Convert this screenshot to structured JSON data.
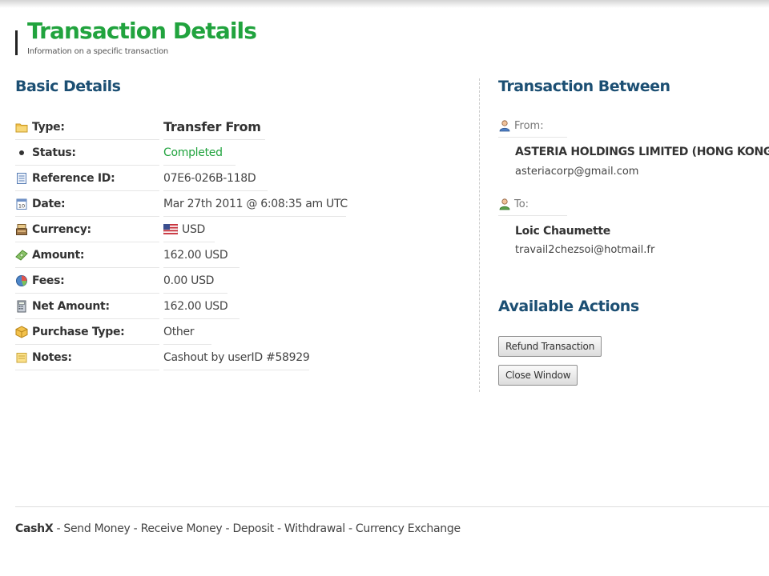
{
  "header": {
    "title": "Transaction Details",
    "subtitle": "Information on a specific transaction"
  },
  "basic_details": {
    "heading": "Basic Details",
    "rows": [
      {
        "label": "Type:",
        "value": "Transfer From",
        "icon": "folder-icon"
      },
      {
        "label": "Status:",
        "value": "Completed",
        "icon": "bullet-icon"
      },
      {
        "label": "Reference ID:",
        "value": "07E6-026B-118D",
        "icon": "document-icon"
      },
      {
        "label": "Date:",
        "value": "Mar 27th 2011 @ 6:08:35 am UTC",
        "icon": "calendar-icon"
      },
      {
        "label": "Currency:",
        "value": "USD",
        "icon": "cash-register-icon"
      },
      {
        "label": "Amount:",
        "value": "162.00 USD",
        "icon": "money-icon"
      },
      {
        "label": "Fees:",
        "value": "0.00 USD",
        "icon": "pie-chart-icon"
      },
      {
        "label": "Net Amount:",
        "value": "162.00 USD",
        "icon": "calculator-icon"
      },
      {
        "label": "Purchase Type:",
        "value": "Other",
        "icon": "box-icon"
      },
      {
        "label": "Notes:",
        "value": "Cashout by userID #58929",
        "icon": "note-icon"
      }
    ],
    "currency_flag_icon": "us-flag-icon"
  },
  "transaction_between": {
    "heading": "Transaction Between",
    "from_label": "From:",
    "from_name": "ASTERIA HOLDINGS LIMITED (HONG KONG)",
    "from_email": "asteriacorp@gmail.com",
    "to_label": "To:",
    "to_name": "Loic Chaumette",
    "to_email": "travail2chezsoi@hotmail.fr"
  },
  "available_actions": {
    "heading": "Available Actions",
    "refund_label": "Refund Transaction",
    "close_label": "Close Window"
  },
  "footer": {
    "brand": "CashX",
    "links": [
      "Send Money",
      "Receive Money",
      "Deposit",
      "Withdrawal",
      "Currency Exchange"
    ],
    "separator": " - "
  },
  "colors": {
    "title_green": "#21a33e",
    "heading_blue": "#1c4f73",
    "status_green": "#21a33e"
  }
}
